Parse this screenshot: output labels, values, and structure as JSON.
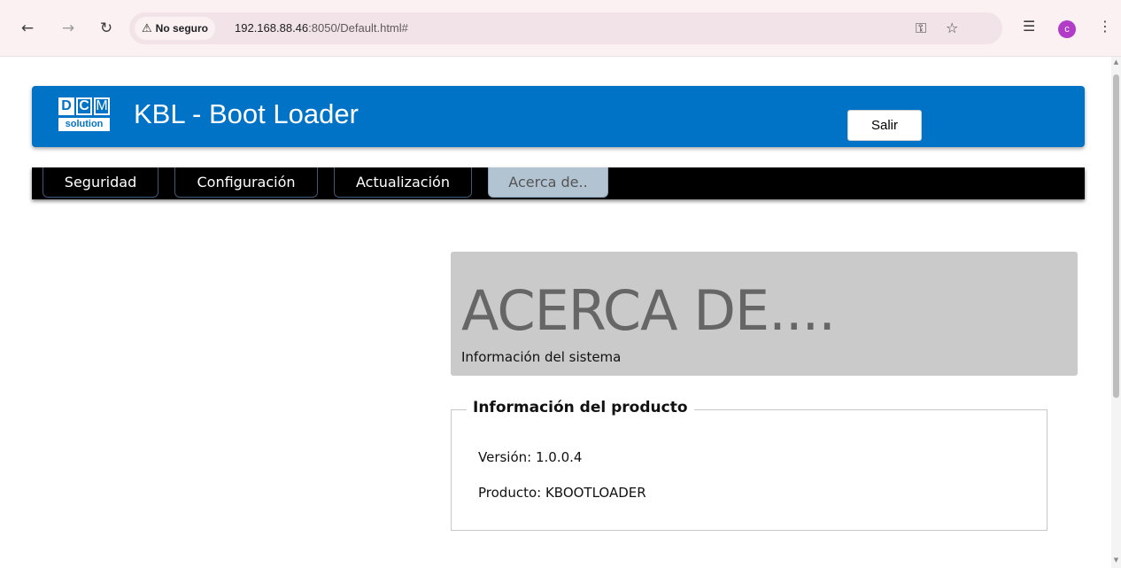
{
  "browser": {
    "security_label": "No seguro",
    "url_host": "192.168.88.46",
    "url_rest": ":8050/Default.html#",
    "avatar_letter": "c",
    "icons": [
      "back-arrow-icon",
      "forward-arrow-icon",
      "reload-icon",
      "warning-icon",
      "key-icon",
      "star-icon",
      "media-queue-icon",
      "kebab-menu-icon"
    ]
  },
  "header": {
    "logo": {
      "letters": [
        "D",
        "C",
        "M"
      ],
      "subtitle": "solution"
    },
    "title": "KBL - Boot Loader",
    "logout_label": "Salir",
    "color": "#0073c6"
  },
  "menu": {
    "tabs": [
      {
        "label": "Seguridad",
        "active": false
      },
      {
        "label": "Configuración",
        "active": false
      },
      {
        "label": "Actualización",
        "active": false
      },
      {
        "label": "Acerca de..",
        "active": true
      }
    ]
  },
  "about": {
    "title": "ACERCA DE....",
    "subtitle": "Información del sistema"
  },
  "product": {
    "legend": "Información del producto",
    "version": "Versión: 1.0.0.4",
    "product": "Producto: KBOOTLOADER"
  }
}
